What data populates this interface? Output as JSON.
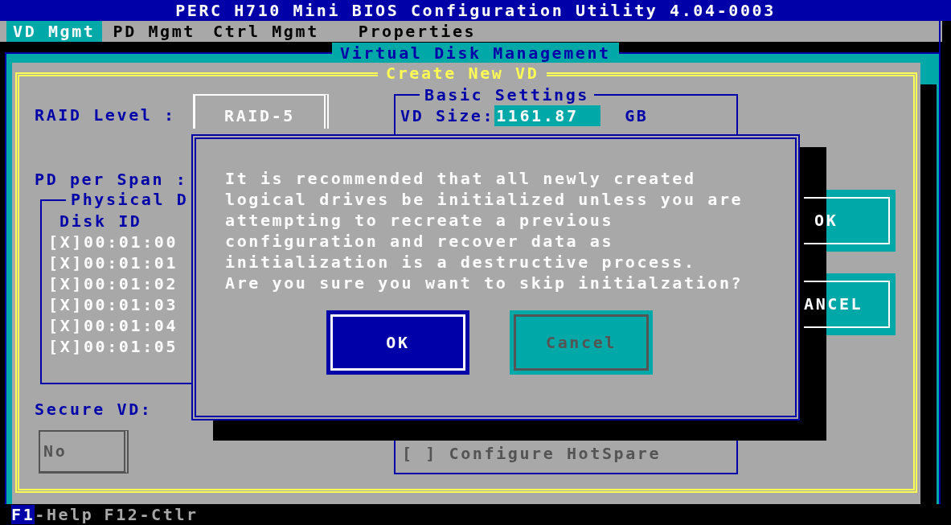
{
  "window": {
    "title": "PERC H710 Mini BIOS Configuration Utility 4.04-0003"
  },
  "tabs": [
    {
      "label": "VD Mgmt",
      "selected": true
    },
    {
      "label": "PD Mgmt",
      "selected": false
    },
    {
      "label": "Ctrl Mgmt",
      "selected": false
    },
    {
      "label": "Properties",
      "selected": false
    }
  ],
  "panel": {
    "title": "Virtual Disk Management"
  },
  "dialog": {
    "title": "Create New VD",
    "raid_level": {
      "label": "RAID Level :",
      "value": "RAID-5"
    },
    "basic_settings": {
      "title": "Basic Settings",
      "vd_size_label": "VD Size:",
      "vd_size": "1161.87",
      "unit": "GB"
    },
    "pd_per_span": {
      "label": "PD per Span :"
    },
    "physical_disks": {
      "title": "Physical D",
      "column": "Disk ID",
      "disks": [
        {
          "label": "[X]00:01:00"
        },
        {
          "label": "[X]00:01:01"
        },
        {
          "label": "[X]00:01:02"
        },
        {
          "label": "[X]00:01:03"
        },
        {
          "label": "[X]00:01:04"
        },
        {
          "label": "[X]00:01:05"
        }
      ]
    },
    "secure_vd": {
      "label": "Secure VD:",
      "value": "No",
      "disabled": true
    },
    "hotspare": {
      "label": "[ ] Configure HotSpare",
      "disabled": true
    },
    "buttons": [
      {
        "label": "OK"
      },
      {
        "label": "ANCEL"
      }
    ]
  },
  "message_box": {
    "message": "It is recommended that all newly created\nlogical drives be initialized unless you are\nattempting to recreate a previous\nconfiguration and recover data as\ninitialization is a destructive process.\nAre you sure you want to skip initialzation?",
    "buttons": [
      {
        "label": "OK",
        "selected": true
      },
      {
        "label": "Cancel",
        "selected": false
      }
    ]
  },
  "status_bar": {
    "keys": [
      {
        "key": "F1",
        "text": "-Help",
        "highlighted": true
      },
      {
        "key": "F12",
        "text": "-Ctlr",
        "highlighted": false
      }
    ]
  }
}
